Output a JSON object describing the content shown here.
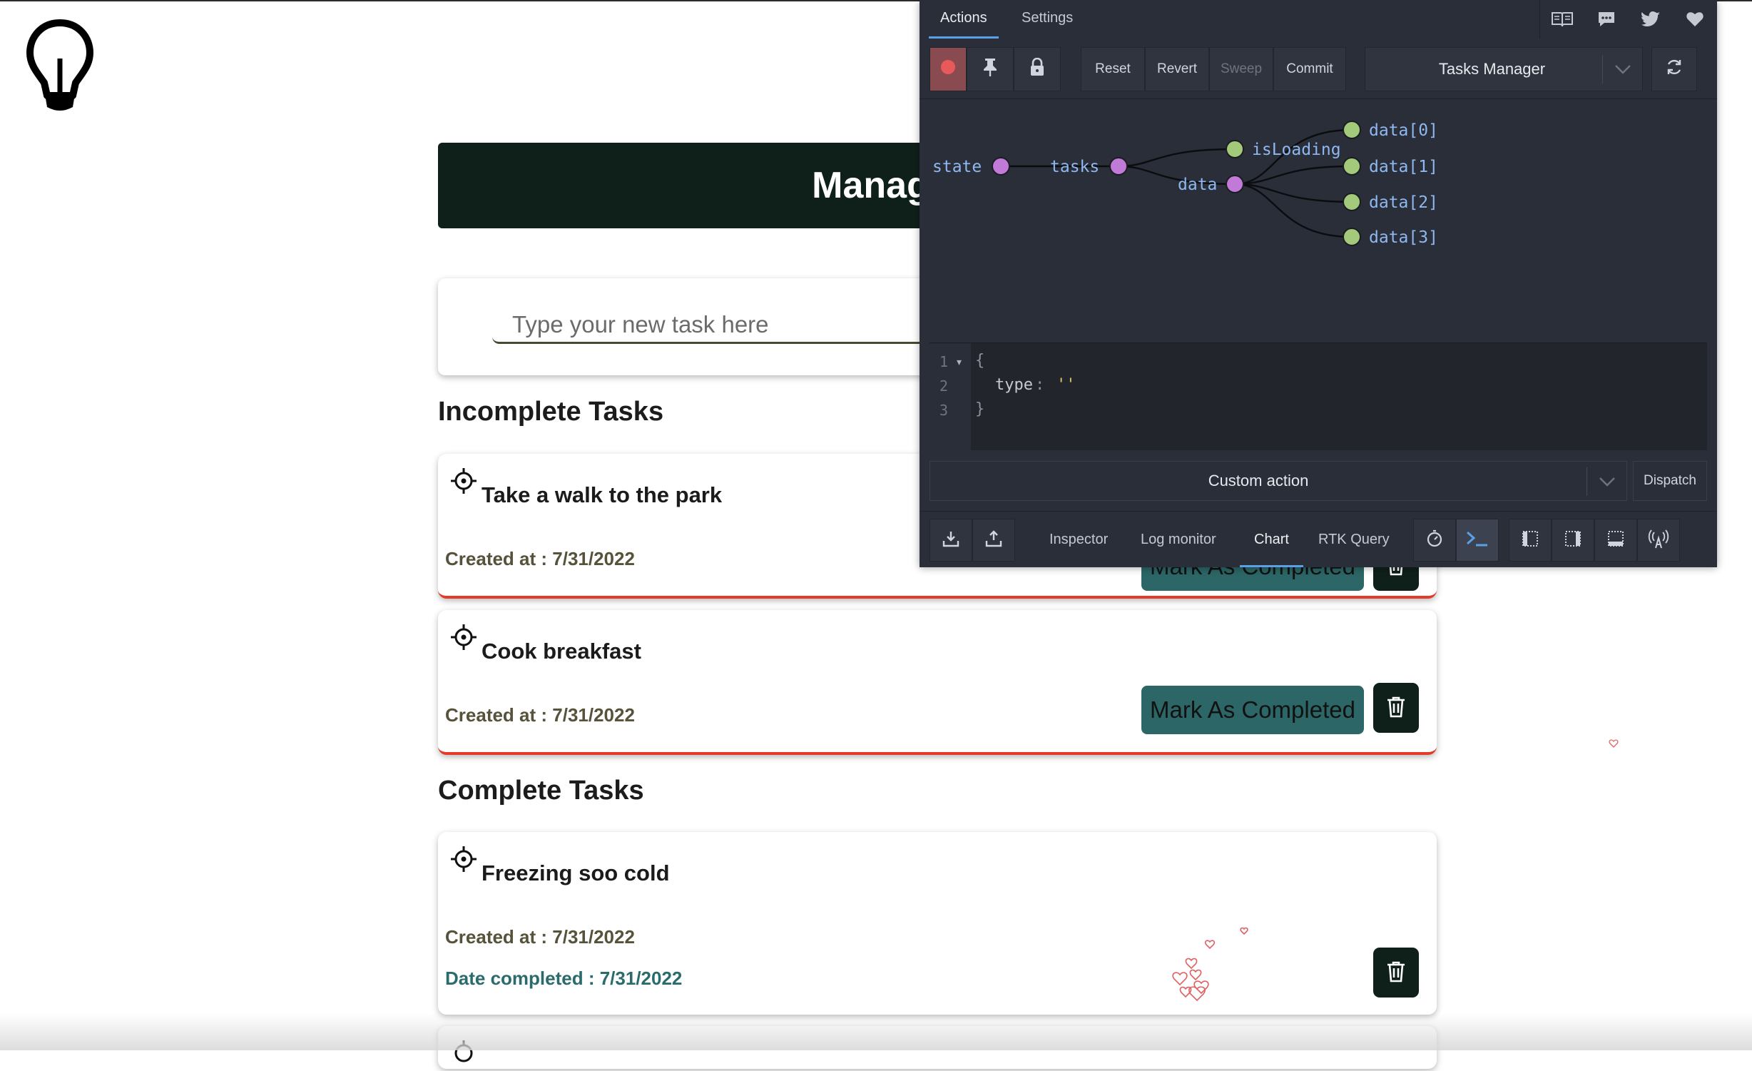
{
  "app": {
    "header_title": "Manage Tasks",
    "input_placeholder": "Type your new task here",
    "incomplete_heading": "Incomplete Tasks",
    "complete_heading": "Complete Tasks",
    "mark_completed_label": "Mark As Completed",
    "incomplete_tasks": [
      {
        "title": "Take a walk to the park",
        "created": "Created at : 7/31/2022"
      },
      {
        "title": "Cook breakfast",
        "created": "Created at : 7/31/2022"
      }
    ],
    "complete_tasks": [
      {
        "title": "Freezing soo cold",
        "created": "Created at : 7/31/2022",
        "completed": "Date completed : 7/31/2022"
      }
    ],
    "colors": {
      "header_bg": "#0f1f19",
      "mark_button": "#2c6666",
      "incomplete_border": "#e23b2a"
    }
  },
  "devtools": {
    "tabs": [
      "Actions",
      "Settings"
    ],
    "toolbar": {
      "reset": "Reset",
      "revert": "Revert",
      "sweep": "Sweep",
      "commit": "Commit",
      "instance": "Tasks Manager"
    },
    "tree": {
      "root": "state",
      "tasks": "tasks",
      "isLoading": "isLoading",
      "data": "data",
      "items": [
        "data[0]",
        "data[1]",
        "data[2]",
        "data[3]"
      ]
    },
    "editor": {
      "lines": [
        "1",
        "2",
        "3"
      ],
      "open": "{",
      "key": "type",
      "colon": ":",
      "value": "''",
      "close": "}"
    },
    "action_select": "Custom action",
    "dispatch": "Dispatch",
    "monitors": [
      "Inspector",
      "Log monitor",
      "Chart",
      "RTK Query"
    ],
    "active_monitor": "Chart",
    "icons": {
      "top": [
        "book-icon",
        "chat-icon",
        "twitter-icon",
        "heart-icon"
      ],
      "toolbar": [
        "record-icon",
        "pin-icon",
        "lock-icon",
        "refresh-icon"
      ],
      "bottom": [
        "import-icon",
        "export-icon",
        "slider-icon",
        "terminal-icon",
        "dock-left-icon",
        "dock-right-icon",
        "dock-bottom-icon",
        "remote-icon"
      ]
    },
    "colors": {
      "node_root": "#c27ad8",
      "node_leaf": "#a3c97a",
      "label": "#8fb8f0"
    }
  }
}
